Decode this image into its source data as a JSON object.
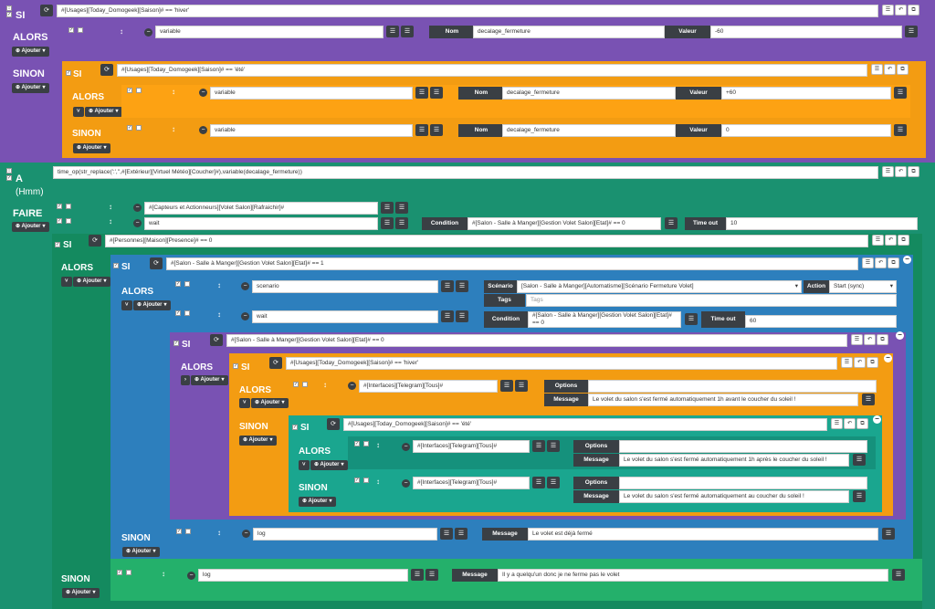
{
  "labels": {
    "si": "SI",
    "alors": "ALORS",
    "sinon": "SINON",
    "a": "A",
    "hmm": "(Hmm)",
    "faire": "FAIRE",
    "ajouter": "Ajouter"
  },
  "top_si": {
    "condition": "#[Usages][Today_Domogeek][Saison]# == 'hiver'"
  },
  "top_alors": {
    "kind": "variable",
    "nom_label": "Nom",
    "nom": "decalage_fermeture",
    "valeur_label": "Valeur",
    "valeur": "-60"
  },
  "inner_si": {
    "condition": "#[Usages][Today_Domogeek][Saison]# == 'été'"
  },
  "inner_alors": {
    "kind": "variable",
    "nom_label": "Nom",
    "nom": "decalage_fermeture",
    "valeur_label": "Valeur",
    "valeur": "+60"
  },
  "inner_sinon": {
    "kind": "variable",
    "nom_label": "Nom",
    "nom": "decalage_fermeture",
    "valeur_label": "Valeur",
    "valeur": "0"
  },
  "a_block": {
    "expr": "time_op(str_replace(':','',#[Extérieur][Virtuel Météo][Coucher]#),variable(decalage_fermeture))"
  },
  "faire": {
    "row1": "#[Capteurs et Actionneurs][Volet Salon][Rafraichir]#",
    "row2_kind": "wait",
    "row2_cond_label": "Condition",
    "row2_cond": "#[Salon - Salle à Manger][Gestion Volet Salon][Etat]# == 0",
    "row2_timeout_label": "Time out",
    "row2_timeout": "10"
  },
  "si_presence": {
    "condition": "#[Personnes][Maison][Presence]# == 0"
  },
  "si_etat1": {
    "condition": "#[Salon - Salle à Manger][Gestion Volet Salon][Etat]# == 1"
  },
  "scenario_row": {
    "kind": "scenario",
    "label": "Scénario",
    "value": "[Salon - Salle à Manger][Automatisme][Scénario Fermeture Volet]",
    "action_label": "Action",
    "action": "Start (sync)",
    "tags_label": "Tags",
    "tags_placeholder": "Tags"
  },
  "wait_row": {
    "kind": "wait",
    "cond_label": "Condition",
    "cond": "#[Salon - Salle à Manger][Gestion Volet Salon][Etat]# == 0",
    "timeout_label": "Time out",
    "timeout": "60"
  },
  "si_etat0": {
    "condition": "#[Salon - Salle à Manger][Gestion Volet Salon][Etat]# == 0"
  },
  "si_hiver2": {
    "condition": "#[Usages][Today_Domogeek][Saison]# == 'hiver'"
  },
  "telegram1": {
    "cmd": "#[Interfaces][Telegram][Tous]#",
    "options_label": "Options",
    "message_label": "Message",
    "message": "Le volet du salon s'est fermé automatiquement 1h avant le coucher du soleil !"
  },
  "si_ete2": {
    "condition": "#[Usages][Today_Domogeek][Saison]# == 'été'"
  },
  "telegram2": {
    "cmd": "#[Interfaces][Telegram][Tous]#",
    "options_label": "Options",
    "message_label": "Message",
    "message": "Le volet du salon s'est fermé automatiquement 1h après le coucher du soleil !"
  },
  "telegram3": {
    "cmd": "#[Interfaces][Telegram][Tous]#",
    "options_label": "Options",
    "message_label": "Message",
    "message": "Le volet du salon s'est fermé automatiquement au coucher du soleil !"
  },
  "log1": {
    "kind": "log",
    "message_label": "Message",
    "message": "Le volet est déjà fermé"
  },
  "log2": {
    "kind": "log",
    "message_label": "Message",
    "message": "Il y a quelqu'un donc je ne ferme pas le volet"
  },
  "colors": {
    "purple": "#7952b3",
    "orange": "#f39c12",
    "green": "#1fa67a",
    "blue": "#2d7fbd",
    "dark": "#3a3f44"
  }
}
